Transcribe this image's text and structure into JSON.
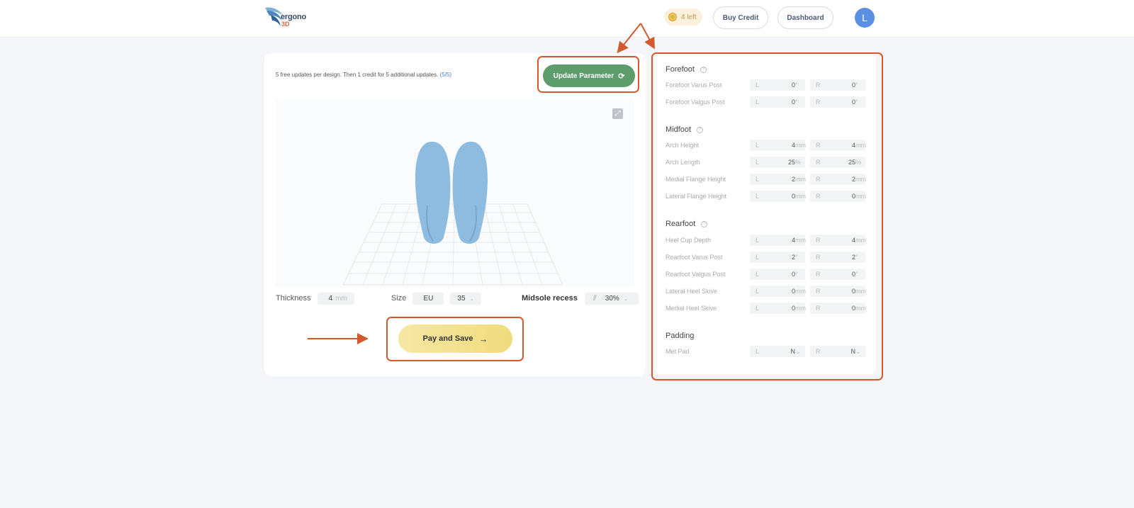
{
  "header": {
    "logo_text": "ergono",
    "logo_sub": "3D",
    "credits_label": "4 left",
    "buy_credit_label": "Buy Credit",
    "dashboard_label": "Dashboard",
    "avatar_initial": "L"
  },
  "left": {
    "free_note": "5 free updates per design. Then 1 credit for 5 additional updates.",
    "free_count": "(5/5)",
    "update_label": "Update Parameter",
    "thickness_label": "Thickness",
    "thickness_value": "4",
    "thickness_unit": "mm",
    "size_label": "Size",
    "size_system": "EU",
    "size_value": "35",
    "midsole_label": "Midsole recess",
    "midsole_value": "30%",
    "pay_label": "Pay and Save"
  },
  "right": {
    "side_l": "L",
    "side_r": "R",
    "forefoot": {
      "title": "Forefoot",
      "rows": [
        {
          "label": "Forefoot Varus Post",
          "l": "0",
          "r": "0",
          "unit": "°"
        },
        {
          "label": "Forefoot Valgus Post",
          "l": "0",
          "r": "0",
          "unit": "°"
        }
      ]
    },
    "midfoot": {
      "title": "Midfoot",
      "rows": [
        {
          "label": "Arch Height",
          "l": "4",
          "r": "4",
          "unit": "mm"
        },
        {
          "label": "Arch Length",
          "l": "25",
          "r": "25",
          "unit": "%"
        },
        {
          "label": "Medial Flange Height",
          "l": "2",
          "r": "2",
          "unit": "mm"
        },
        {
          "label": "Lateral Flange Height",
          "l": "0",
          "r": "0",
          "unit": "mm"
        }
      ]
    },
    "rearfoot": {
      "title": "Rearfoot",
      "rows": [
        {
          "label": "Heel Cup Depth",
          "l": "4",
          "r": "4",
          "unit": "mm"
        },
        {
          "label": "Rearfoot Varus Post",
          "l": "2",
          "r": "2",
          "unit": "°"
        },
        {
          "label": "Rearfoot Valgus Post",
          "l": "0",
          "r": "0",
          "unit": "°"
        },
        {
          "label": "Lateral Heel Skive",
          "l": "0",
          "r": "0",
          "unit": "mm"
        },
        {
          "label": "Medial Heel Skive",
          "l": "0",
          "r": "0",
          "unit": "mm"
        }
      ]
    },
    "padding": {
      "title": "Padding",
      "rows": [
        {
          "label": "Met Pad",
          "l": "N",
          "r": "N",
          "unit": "⌄"
        }
      ]
    }
  },
  "colors": {
    "accent_green": "#5d9c6b",
    "pay_yellow": "#f0dc7c",
    "annotation": "#d45a2e",
    "avatar_blue": "#5b8fe4"
  }
}
